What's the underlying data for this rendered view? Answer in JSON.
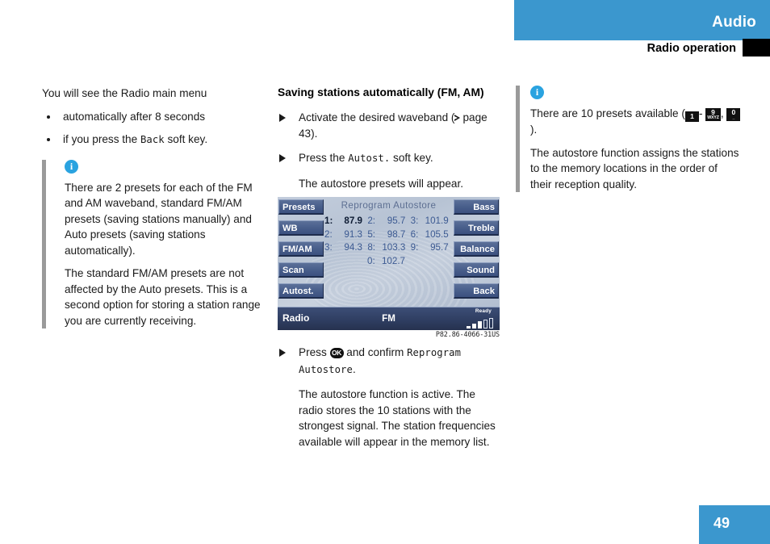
{
  "header": {
    "title": "Audio",
    "subtitle": "Radio operation",
    "accent_color": "#3b97ce"
  },
  "left_column": {
    "intro": "You will see the Radio main menu",
    "bullets": [
      {
        "text_before": "automatically after 8 seconds",
        "mono": "",
        "text_after": ""
      },
      {
        "text_before": "if you press the ",
        "mono": "Back",
        "text_after": " soft key."
      }
    ],
    "note": {
      "icon": "info-icon",
      "paragraphs": [
        "There are 2 presets for each of the FM and AM waveband, standard FM/AM presets (saving stations manually) and Auto presets (saving stations automatically).",
        "The standard FM/AM presets are not affected by the Auto presets. This is a second option for storing a station range you are currently receiving."
      ]
    }
  },
  "middle_column": {
    "section_title": "Saving stations automatically (FM, AM)",
    "steps": [
      {
        "text_before": "Activate the desired waveband (",
        "page_ref": "page 43",
        "text_after": ")."
      },
      {
        "text_before": "Press the ",
        "mono": "Autost.",
        "text_after": " soft key."
      }
    ],
    "step_note_1": "The autostore presets will appear.",
    "step_confirm": {
      "text_before": "Press ",
      "key": "OK",
      "text_mid": " and confirm ",
      "mono": "Reprogram Autostore",
      "text_after": "."
    },
    "result_paragraph": "The autostore function is active. The radio stores the 10 stations with the strongest signal. The station frequencies available will appear in the memory list.",
    "figure": {
      "caption": "P82.86-4066-31US",
      "screen_title": "Reprogram Autostore",
      "soft_keys_left": [
        "Presets",
        "WB",
        "FM/AM",
        "Scan",
        "Autost."
      ],
      "soft_keys_right": [
        "Bass",
        "Treble",
        "Balance",
        "Sound",
        "Back"
      ],
      "presets": [
        [
          {
            "index": "1:",
            "freq": "87.9",
            "active": true
          },
          {
            "index": "2:",
            "freq": "95.7",
            "active": false
          },
          {
            "index": "3:",
            "freq": "101.9",
            "active": false
          }
        ],
        [
          {
            "index": "2:",
            "freq": "91.3",
            "active": false
          },
          {
            "index": "5:",
            "freq": "98.7",
            "active": false
          },
          {
            "index": "6:",
            "freq": "105.5",
            "active": false
          }
        ],
        [
          {
            "index": "3:",
            "freq": "94.3",
            "active": false
          },
          {
            "index": "8:",
            "freq": "103.3",
            "active": false
          },
          {
            "index": "9:",
            "freq": "95.7",
            "active": false
          }
        ]
      ],
      "preset_last": {
        "index": "0:",
        "freq": "102.7",
        "active": false
      },
      "status": {
        "source": "Radio",
        "band": "FM",
        "ready_label": "Ready"
      }
    }
  },
  "right_column": {
    "note": {
      "icon": "info-icon",
      "presets_text_before": "There are 10 presets available (",
      "key_1": {
        "num": "1",
        "sub": ""
      },
      "dash": "-",
      "key_9": {
        "num": "9",
        "sub": "WXYZ"
      },
      "comma": ",",
      "key_0": {
        "num": "0",
        "sub": "_"
      },
      "presets_text_after": ").",
      "paragraph": "The autostore function assigns the stations to the memory locations in the order of their reception quality."
    }
  },
  "footer": {
    "page_number": "49"
  }
}
